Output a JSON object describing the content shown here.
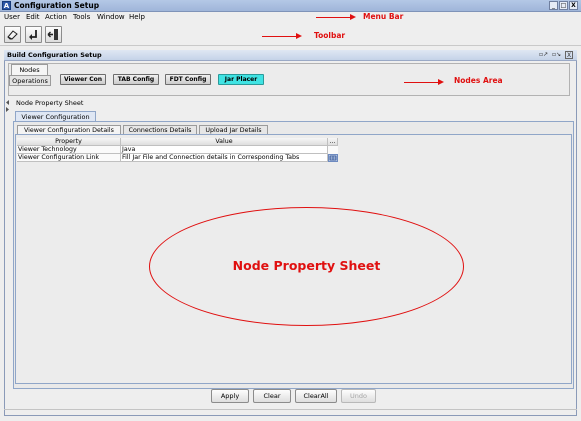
{
  "window": {
    "title": "Configuration Setup",
    "app_icon": "app-logo-icon",
    "controls": [
      "_",
      "□",
      "X"
    ]
  },
  "menu": [
    "User",
    "Edit",
    "Action",
    "Tools",
    "Window",
    "Help"
  ],
  "toolbar": {
    "buttons": [
      {
        "icon": "eraser-icon"
      },
      {
        "icon": "undo-arrow-icon"
      },
      {
        "icon": "exit-door-icon"
      }
    ]
  },
  "annotations": {
    "menu_bar": "Menu Bar",
    "toolbar": "Toolbar",
    "nodes_area": "Nodes Area",
    "node_property_sheet": "Node Property Sheet",
    "color": "#e01010"
  },
  "frame": {
    "title": "Build Configuration Setup",
    "controls": [
      "▫↗",
      "▫↘",
      "X"
    ]
  },
  "nodes_panel": {
    "tabs": [
      "Nodes",
      "Operations"
    ],
    "buttons": [
      "Viewer Con",
      "TAB Config",
      "FDT Config",
      "Jar Placer"
    ],
    "selected_color": "#3fe3e3"
  },
  "property_sheet": {
    "title": "Node Property Sheet",
    "main_tab": "Viewer Configuration",
    "sub_tabs": [
      "Viewer Configuration Details",
      "Connections Details",
      "Upload Jar Details"
    ],
    "table": {
      "headers": [
        "Property",
        "Value",
        "..."
      ],
      "rows": [
        {
          "property": "Viewer Technology",
          "value": "Java"
        },
        {
          "property": "Viewer Configuration Link",
          "value": "Fill Jar File and Connection details in Corresponding Tabs"
        }
      ]
    }
  },
  "bottom_buttons": [
    {
      "label": "Apply",
      "enabled": true
    },
    {
      "label": "Clear",
      "enabled": true
    },
    {
      "label": "ClearAll",
      "enabled": true
    },
    {
      "label": "Undo",
      "enabled": false
    }
  ]
}
